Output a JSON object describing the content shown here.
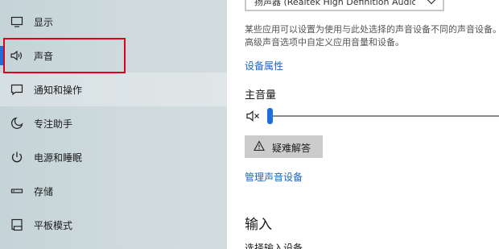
{
  "sidebar": {
    "items": [
      {
        "label": "显示",
        "icon": "monitor-icon"
      },
      {
        "label": "声音",
        "icon": "speaker-icon"
      },
      {
        "label": "通知和操作",
        "icon": "notification-icon"
      },
      {
        "label": "专注助手",
        "icon": "moon-icon"
      },
      {
        "label": "电源和睡眠",
        "icon": "power-icon"
      },
      {
        "label": "存储",
        "icon": "storage-icon"
      },
      {
        "label": "平板模式",
        "icon": "tablet-icon"
      }
    ],
    "selected": "声音",
    "accent_color": "#1e6fd9",
    "highlight_box_color": "#e0001b"
  },
  "main": {
    "output_device": {
      "value": "扬声器 (Realtek High Definition Audio)"
    },
    "description": "某些应用可以设置为使用与此处选择的声音设备不同的声音设备。在高级声音选项中自定义应用音量和设备。",
    "device_properties_link": "设备属性",
    "master_volume": {
      "label": "主音量",
      "value": 0,
      "muted": true
    },
    "troubleshoot_button": "疑难解答",
    "manage_devices_link": "管理声音设备",
    "input_heading": "输入",
    "input_device_label": "选择输入设备"
  },
  "colors": {
    "link": "#1967c2",
    "button_bg": "#cccccc"
  }
}
